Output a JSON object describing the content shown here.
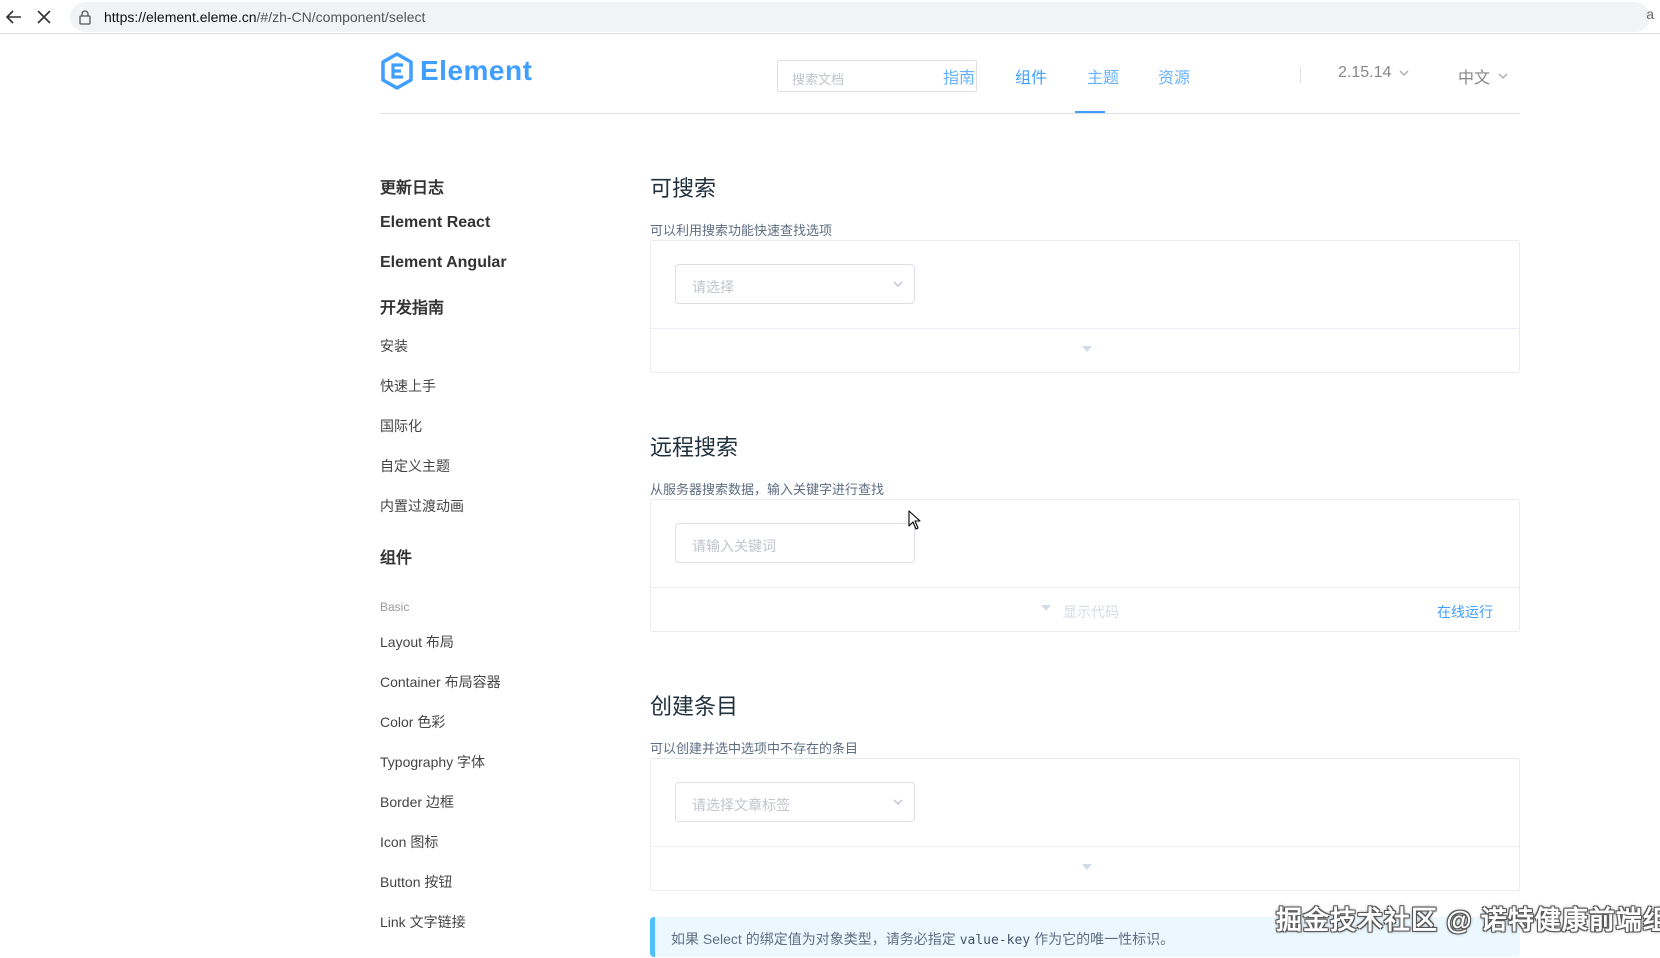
{
  "browser": {
    "url_host": "https://element.eleme.cn",
    "url_rest": "/#/zh-CN/component/select",
    "aa": "a"
  },
  "header": {
    "logo_text": "Element",
    "search_placeholder": "搜索文档",
    "nav": [
      "指南",
      "组件",
      "主题",
      "资源"
    ],
    "active_nav": "组件",
    "version": "2.15.14",
    "language": "中文",
    "accent_color": "#409eff"
  },
  "sidebar": {
    "heading_changelog": "更新日志",
    "heading_react": "Element React",
    "heading_angular": "Element Angular",
    "heading_dev_guide": "开发指南",
    "guide_items": [
      "安装",
      "快速上手",
      "国际化",
      "自定义主题",
      "内置过渡动画"
    ],
    "heading_components": "组件",
    "group_basic": "Basic",
    "basic_items": [
      "Layout 布局",
      "Container 布局容器",
      "Color 色彩",
      "Typography 字体",
      "Border 边框",
      "Icon 图标",
      "Button 按钮",
      "Link 文字链接"
    ]
  },
  "sections": [
    {
      "title": "可搜索",
      "desc": "可以利用搜索功能快速查找选项",
      "placeholder": "请选择",
      "has_arrow": true,
      "show_code": "",
      "run": ""
    },
    {
      "title": "远程搜索",
      "desc": "从服务器搜索数据，输入关键字进行查找",
      "placeholder": "请输入关键词",
      "has_arrow": false,
      "show_code": "显示代码",
      "run": "在线运行"
    },
    {
      "title": "创建条目",
      "desc": "可以创建并选中选项中不存在的条目",
      "placeholder": "请选择文章标签",
      "has_arrow": true,
      "show_code": "",
      "run": ""
    }
  ],
  "tip": {
    "before": "如果 Select 的绑定值为对象类型，请务必指定",
    "code": "value-key",
    "after": "作为它的唯一性标识。"
  },
  "watermark": "掘金技术社区 @ 诺特健康前端组"
}
